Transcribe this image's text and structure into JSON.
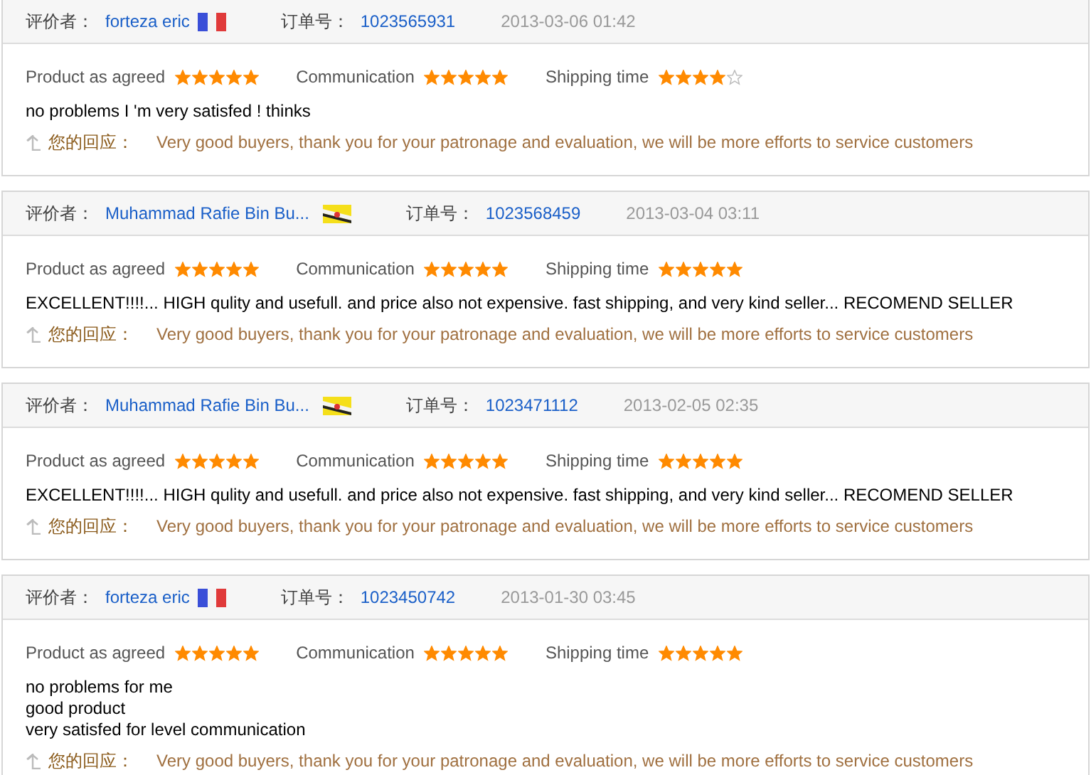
{
  "reviews": [
    {
      "reviewer_label": "评价者：",
      "reviewer": "forteza eric",
      "flag": {
        "kind": "tricolor"
      },
      "order_label": "订单号：",
      "order_no": "1023565931",
      "date": "2013-03-06 01:42",
      "ratings": [
        {
          "label": "Product as agreed",
          "stars": 5
        },
        {
          "label": "Communication",
          "stars": 5
        },
        {
          "label": "Shipping time",
          "stars": 4
        }
      ],
      "comment_lines": [
        "no problems I 'm very satisfed ! thinks"
      ],
      "reply_label": "您的回应：",
      "reply": "Very good buyers, thank you for your patronage and evaluation, we will be more efforts to service customers"
    },
    {
      "reviewer_label": "评价者：",
      "reviewer": "Muhammad Rafie Bin Bu...",
      "flag": {
        "kind": "striped"
      },
      "order_label": "订单号：",
      "order_no": "1023568459",
      "date": "2013-03-04 03:11",
      "ratings": [
        {
          "label": "Product as agreed",
          "stars": 5
        },
        {
          "label": "Communication",
          "stars": 5
        },
        {
          "label": "Shipping time",
          "stars": 5
        }
      ],
      "comment_lines": [
        "EXCELLENT!!!!... HIGH qulity and usefull. and price also not expensive. fast shipping, and very kind seller... RECOMEND SELLER"
      ],
      "reply_label": "您的回应：",
      "reply": "Very good buyers, thank you for your patronage and evaluation, we will be more efforts to service customers"
    },
    {
      "reviewer_label": "评价者：",
      "reviewer": "Muhammad Rafie Bin Bu...",
      "flag": {
        "kind": "striped"
      },
      "order_label": "订单号：",
      "order_no": "1023471112",
      "date": "2013-02-05 02:35",
      "ratings": [
        {
          "label": "Product as agreed",
          "stars": 5
        },
        {
          "label": "Communication",
          "stars": 5
        },
        {
          "label": "Shipping time",
          "stars": 5
        }
      ],
      "comment_lines": [
        "EXCELLENT!!!!... HIGH qulity and usefull. and price also not expensive. fast shipping, and very kind seller... RECOMEND SELLER"
      ],
      "reply_label": "您的回应：",
      "reply": "Very good buyers, thank you for your patronage and evaluation, we will be more efforts to service customers"
    },
    {
      "reviewer_label": "评价者：",
      "reviewer": "forteza eric",
      "flag": {
        "kind": "tricolor"
      },
      "order_label": "订单号：",
      "order_no": "1023450742",
      "date": "2013-01-30 03:45",
      "ratings": [
        {
          "label": "Product as agreed",
          "stars": 5
        },
        {
          "label": "Communication",
          "stars": 5
        },
        {
          "label": "Shipping time",
          "stars": 5
        }
      ],
      "comment_lines": [
        "no problems for me",
        "good product",
        "very satisfed for level communication"
      ],
      "reply_label": "您的回应：",
      "reply": "Very good buyers, thank you for your patronage and evaluation, we will be more efforts to service customers"
    }
  ]
}
